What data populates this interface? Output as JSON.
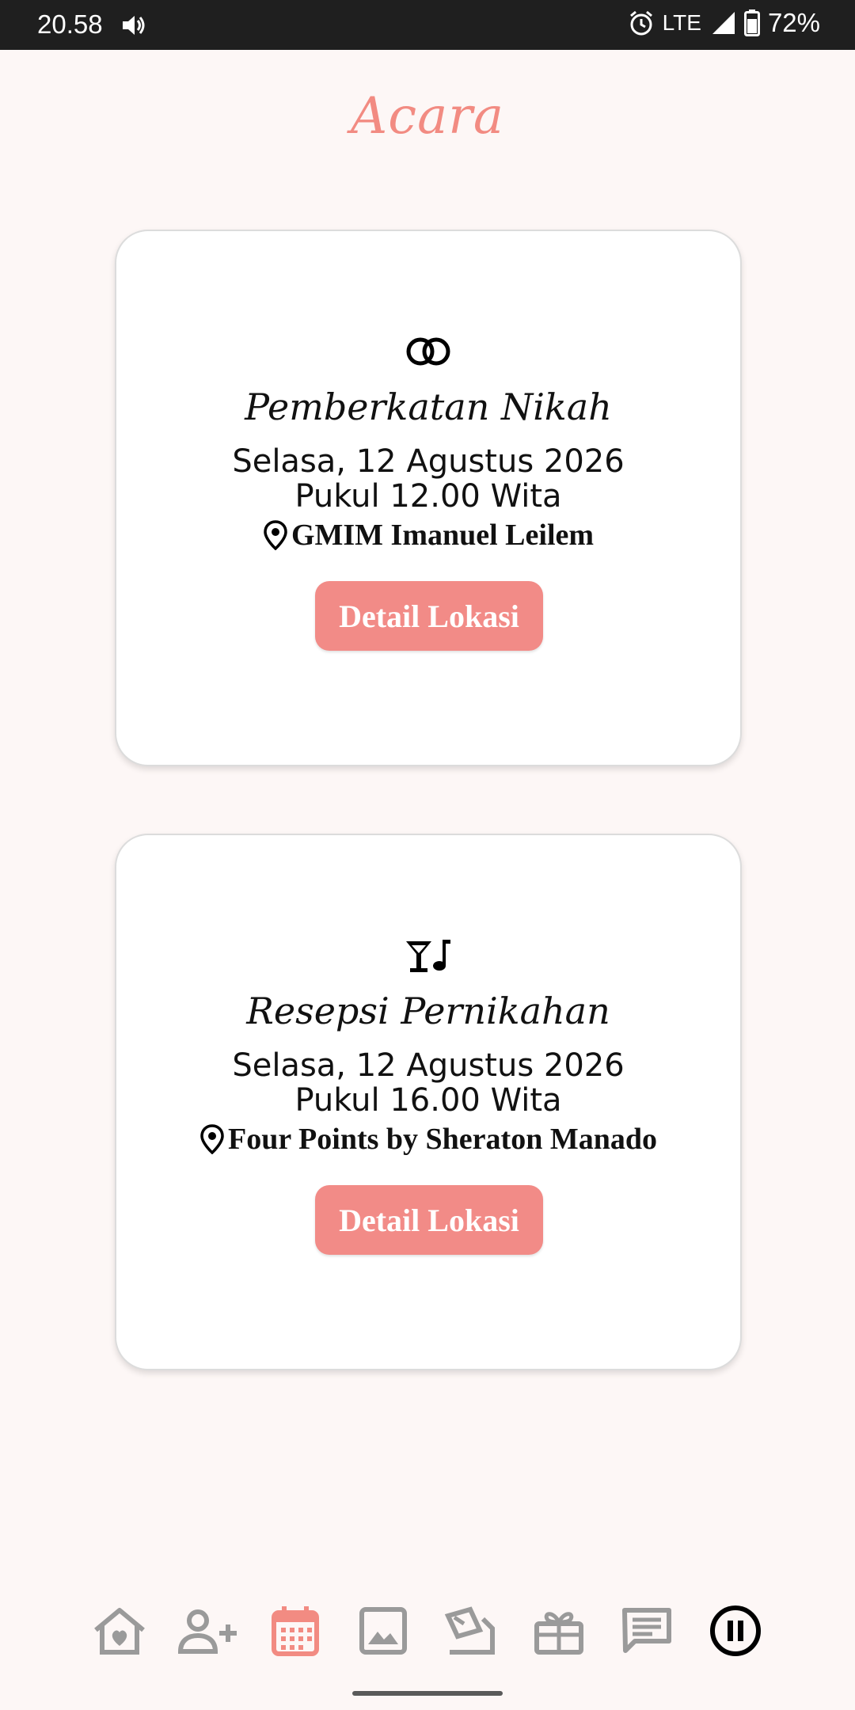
{
  "status_bar": {
    "time": "20.58",
    "network": "LTE",
    "battery": "72%",
    "icons": [
      "sound-icon",
      "alarm-icon",
      "signal-icon",
      "battery-icon"
    ]
  },
  "page": {
    "title": "Acara",
    "accent_color": "#f28b82"
  },
  "events": [
    {
      "icon": "rings-icon",
      "title": "Pemberkatan Nikah",
      "date": "Selasa, 12 Agustus 2026",
      "time": "Pukul 12.00 Wita",
      "location": "GMIM Imanuel Leilem",
      "button_label": "Detail Lokasi"
    },
    {
      "icon": "cocktail-music-icon",
      "title": "Resepsi Pernikahan",
      "date": "Selasa, 12 Agustus 2026",
      "time": "Pukul 16.00 Wita",
      "location": "Four Points by Sheraton Manado",
      "button_label": "Detail Lokasi"
    }
  ],
  "bottom_nav": {
    "items": [
      "home-heart-icon",
      "add-guest-icon",
      "calendar-icon",
      "gallery-icon",
      "message-card-icon",
      "gift-icon",
      "chat-icon",
      "pause-icon"
    ],
    "active": "calendar-icon",
    "active_color": "#f28b82",
    "inactive_color": "#9a9a9a"
  }
}
